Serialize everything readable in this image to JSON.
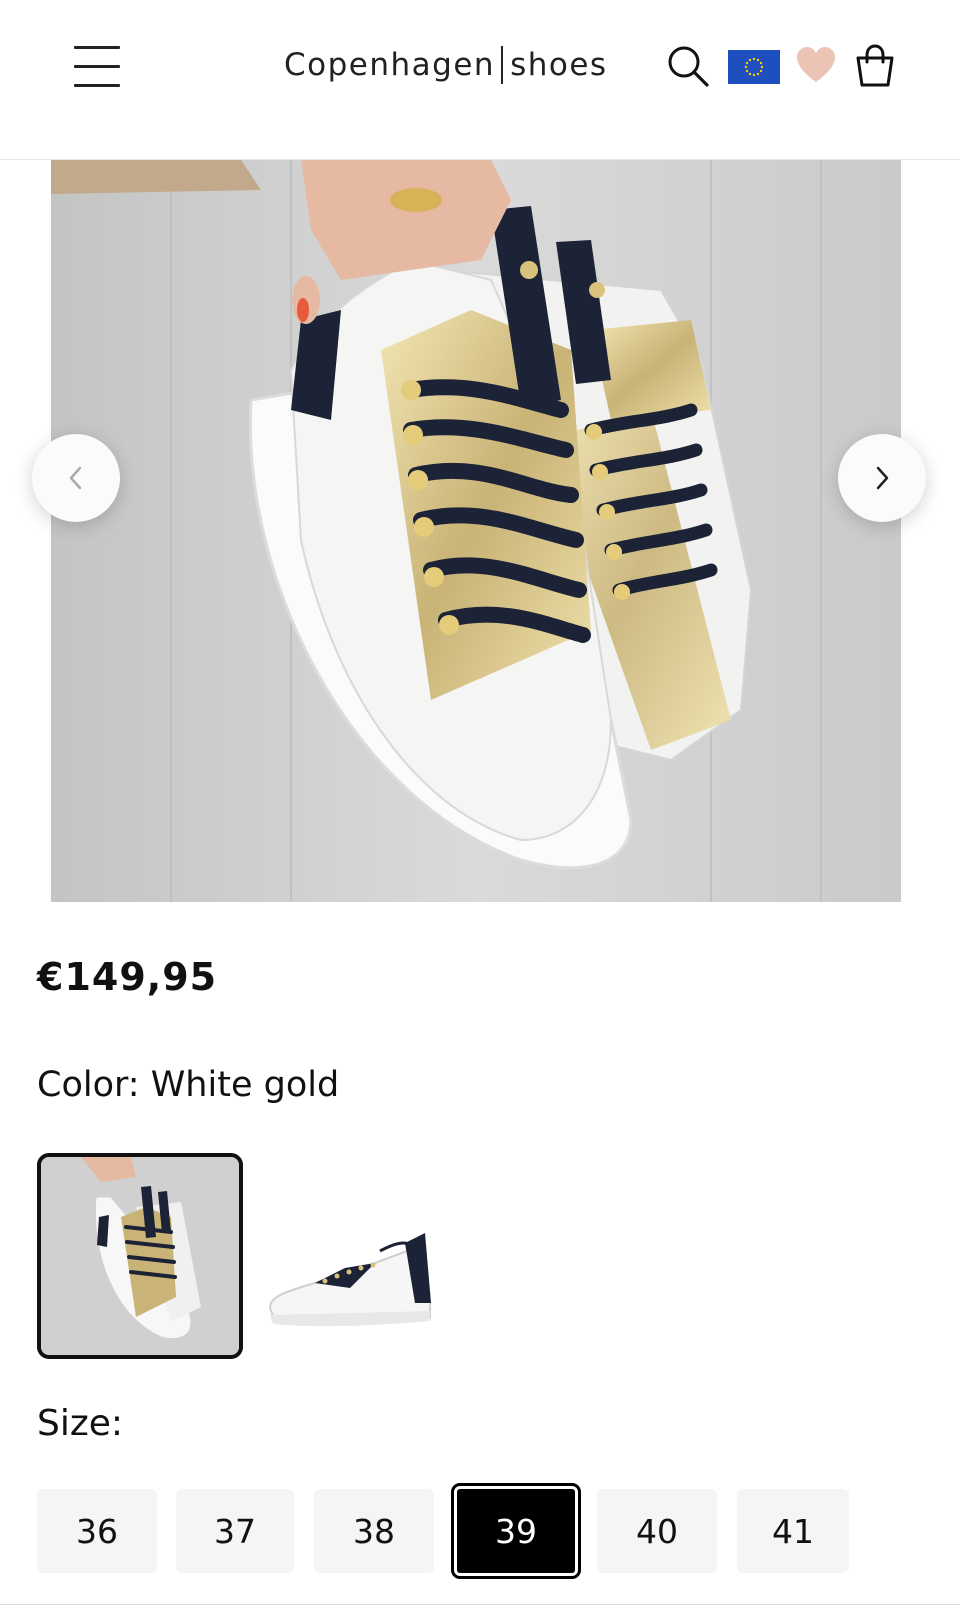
{
  "header": {
    "menu_icon": "hamburger-menu-icon",
    "logo_left": "Copenhagen",
    "logo_right": "shoes",
    "search_icon": "search-icon",
    "region_icon": "eu-flag-icon",
    "wishlist_icon": "heart-icon",
    "cart_icon": "shopping-bag-icon"
  },
  "carousel": {
    "prev_icon": "chevron-left-icon",
    "next_icon": "chevron-right-icon"
  },
  "product": {
    "price": "€149,95",
    "color_label": "Color:",
    "color_value": "White gold",
    "size_label": "Size:",
    "sizes": [
      "36",
      "37",
      "38",
      "39",
      "40",
      "41"
    ],
    "selected_size": "39"
  },
  "colors": {
    "text": "#111111",
    "selected_size_bg": "#000000",
    "size_bg": "#f5f5f5",
    "flag_blue": "#1f4fbf",
    "flag_stars": "#f5d000",
    "heart": "#ecc4b6"
  }
}
